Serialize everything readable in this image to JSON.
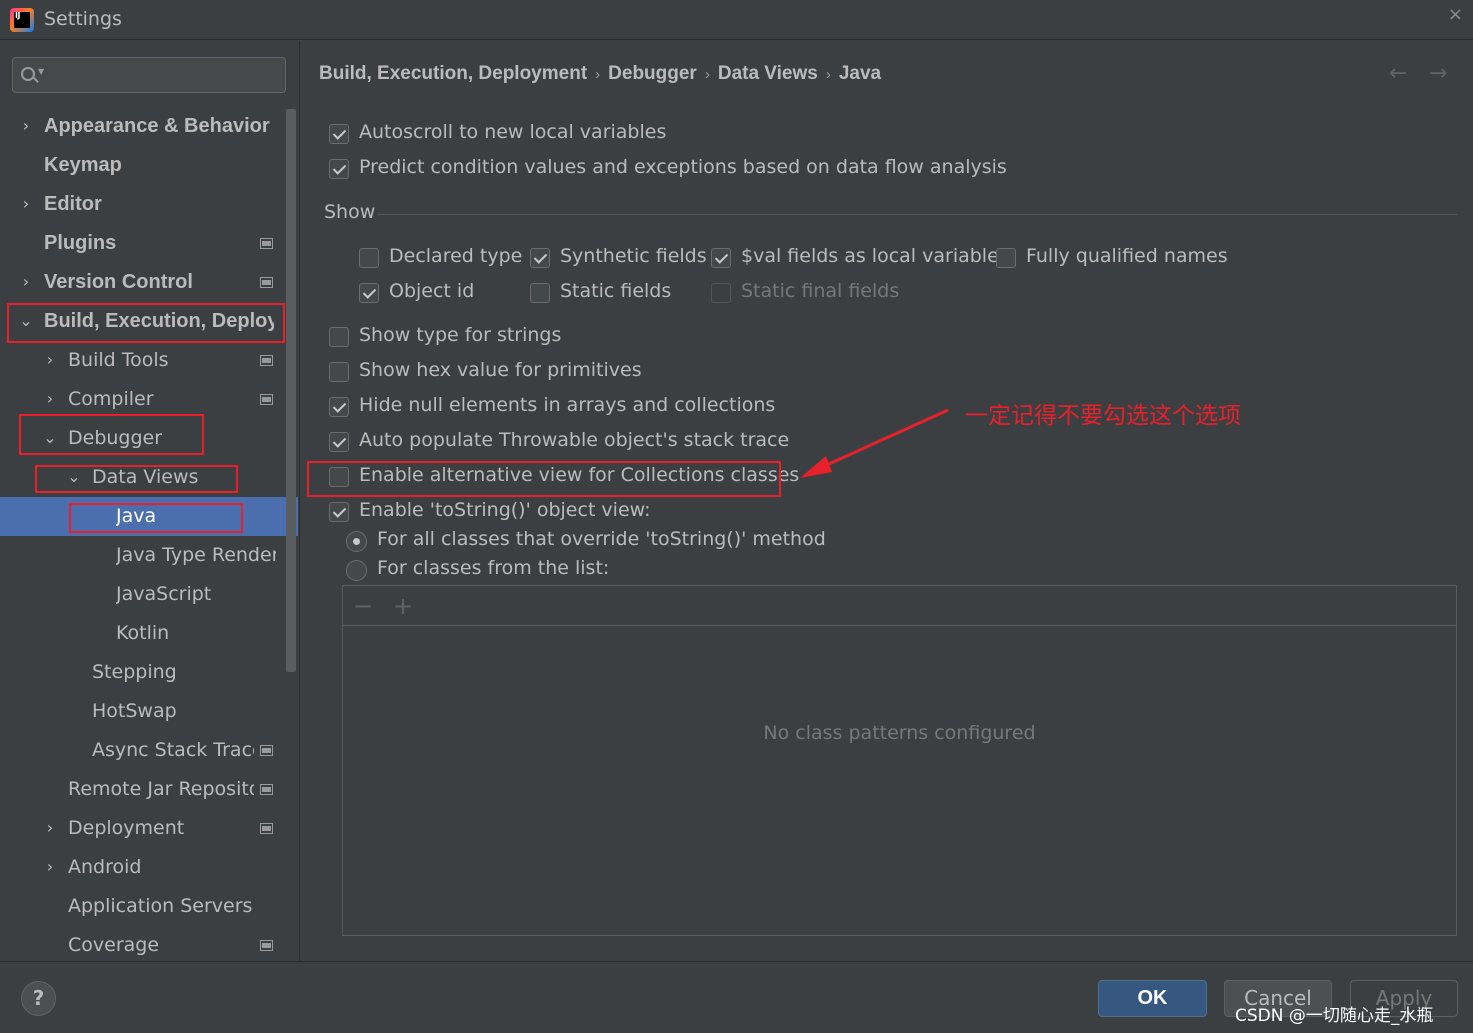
{
  "window": {
    "app_icon_text": "IJ",
    "title": "Settings",
    "close_glyph": "×"
  },
  "search": {
    "placeholder": ""
  },
  "tree": {
    "items": [
      {
        "label": "Appearance & Behavior",
        "expand": "›"
      },
      {
        "label": "Keymap"
      },
      {
        "label": "Editor",
        "expand": "›"
      },
      {
        "label": "Plugins"
      },
      {
        "label": "Version Control",
        "expand": "›"
      },
      {
        "label": "Build, Execution, Deploym",
        "expand": "⌄"
      },
      {
        "label": "Build Tools",
        "expand": "›"
      },
      {
        "label": "Compiler",
        "expand": "›"
      },
      {
        "label": "Debugger",
        "expand": "⌄"
      },
      {
        "label": "Data Views",
        "expand": "⌄"
      },
      {
        "label": "Java"
      },
      {
        "label": "Java Type Rendere"
      },
      {
        "label": "JavaScript"
      },
      {
        "label": "Kotlin"
      },
      {
        "label": "Stepping"
      },
      {
        "label": "HotSwap"
      },
      {
        "label": "Async Stack Traces"
      },
      {
        "label": "Remote Jar Repositori"
      },
      {
        "label": "Deployment",
        "expand": "›"
      },
      {
        "label": "Android",
        "expand": "›"
      },
      {
        "label": "Application Servers"
      },
      {
        "label": "Coverage"
      }
    ],
    "selected": "Java"
  },
  "breadcrumb": {
    "parts": [
      "Build, Execution, Deployment",
      "Debugger",
      "Data Views",
      "Java"
    ],
    "separator": "›",
    "back_glyph": "←",
    "forward_glyph": "→"
  },
  "options": {
    "autoscroll": {
      "label": "Autoscroll to new local variables",
      "checked": true
    },
    "predict": {
      "label": "Predict condition values and exceptions based on data flow analysis",
      "checked": true
    },
    "show_title": "Show",
    "declared_type": {
      "label": "Declared type",
      "checked": false
    },
    "synthetic_fields": {
      "label": "Synthetic fields",
      "checked": true
    },
    "val_fields": {
      "label": "$val fields as local variables",
      "checked": true
    },
    "fully_qualified": {
      "label": "Fully qualified names",
      "checked": false
    },
    "object_id": {
      "label": "Object id",
      "checked": true
    },
    "static_fields": {
      "label": "Static fields",
      "checked": false
    },
    "static_final_fields": {
      "label": "Static final fields",
      "checked": false,
      "disabled": true
    },
    "type_for_strings": {
      "label": "Show type for strings",
      "checked": false
    },
    "hex_primitives": {
      "label": "Show hex value for primitives",
      "checked": false
    },
    "hide_null": {
      "label": "Hide null elements in arrays and collections",
      "checked": true
    },
    "throwable_trace": {
      "label": "Auto populate Throwable object's stack trace",
      "checked": true
    },
    "alt_collections": {
      "label": "Enable alternative view for Collections classes",
      "checked": false
    },
    "tostring_view": {
      "label": "Enable 'toString()' object view:",
      "checked": true
    },
    "radio_all": {
      "label": "For all classes that override 'toString()' method",
      "selected": true
    },
    "radio_list": {
      "label": "For classes from the list:",
      "selected": false
    }
  },
  "list_panel": {
    "remove_glyph": "−",
    "add_glyph": "+",
    "empty_text": "No class patterns configured"
  },
  "annotation": {
    "text": "一定记得不要勾选这个选项",
    "color": "#e8202b"
  },
  "footer": {
    "help_glyph": "?",
    "ok_label": "OK",
    "cancel_label": "Cancel",
    "apply_label": "Apply"
  },
  "watermark": "CSDN @一切随心走_水瓶",
  "colors": {
    "background": "#3c3f41",
    "selection": "#4b6eaf",
    "ok_button": "#365880",
    "highlight_box": "#e8202b"
  }
}
